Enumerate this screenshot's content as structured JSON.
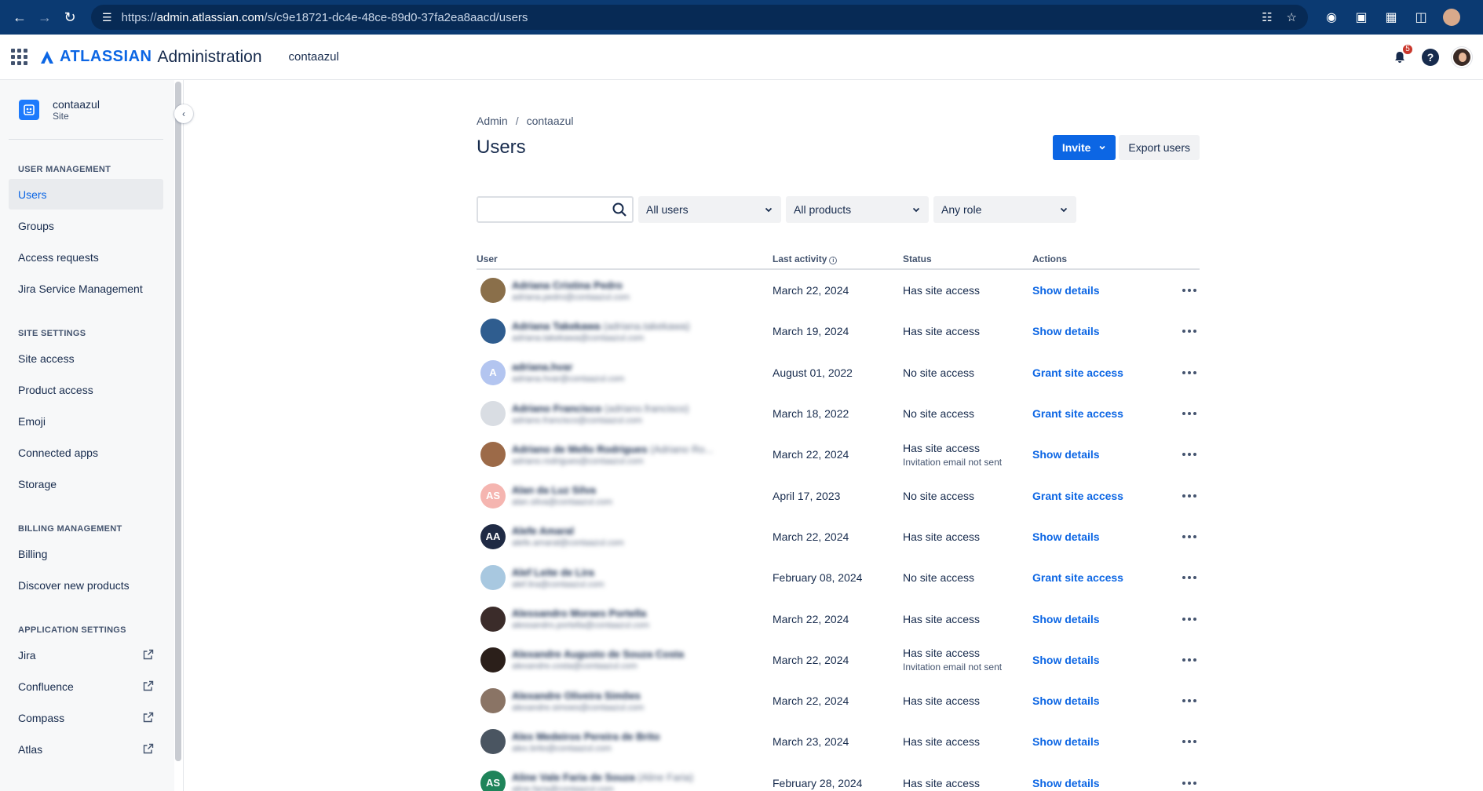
{
  "browser": {
    "url_prefix": "https://",
    "url_domain": "admin.atlassian.com",
    "url_path": "/s/c9e18721-dc4e-48ce-89d0-37fa2ea8aacd/users"
  },
  "header": {
    "brand": "ATLASSIAN",
    "product": "Administration",
    "site": "contaazul",
    "notifications_count": "5",
    "help": "?"
  },
  "sidebar": {
    "site_name": "contaazul",
    "site_type": "Site",
    "sections": [
      {
        "title": "USER MANAGEMENT",
        "items": [
          "Users",
          "Groups",
          "Access requests",
          "Jira Service Management"
        ]
      },
      {
        "title": "SITE SETTINGS",
        "items": [
          "Site access",
          "Product access",
          "Emoji",
          "Connected apps",
          "Storage"
        ]
      },
      {
        "title": "BILLING MANAGEMENT",
        "items": [
          "Billing",
          "Discover new products"
        ]
      },
      {
        "title": "APPLICATION SETTINGS",
        "items": [
          "Jira",
          "Confluence",
          "Compass",
          "Atlas"
        ]
      }
    ]
  },
  "breadcrumb": {
    "root": "Admin",
    "current": "contaazul"
  },
  "page_title": "Users",
  "actions": {
    "invite": "Invite",
    "export": "Export users"
  },
  "filters": {
    "search_placeholder": "",
    "users": "All users",
    "products": "All products",
    "role": "Any role"
  },
  "table": {
    "headers": {
      "user": "User",
      "last_activity": "Last activity",
      "status": "Status",
      "actions": "Actions"
    },
    "rows": [
      {
        "initials": "",
        "avatar_color": "#8a6f4a",
        "name": "Adriana Cristina Pedro",
        "alt": "",
        "email": "adriana.pedro@contaazul.com",
        "activity": "March 22, 2024",
        "status": "Has site access",
        "sub": "",
        "action": "Show details"
      },
      {
        "initials": "",
        "avatar_color": "#2f5d8f",
        "name": "Adriana Takekawa",
        "alt": "(adriana.takekawa)",
        "email": "adriana.takekawa@contaazul.com",
        "activity": "March 19, 2024",
        "status": "Has site access",
        "sub": "",
        "action": "Show details"
      },
      {
        "initials": "A",
        "avatar_color": "#b3c5f0",
        "name": "adriana.hvar",
        "alt": "",
        "email": "adriana.hvar@contaazul.com",
        "activity": "August 01, 2022",
        "status": "No site access",
        "sub": "",
        "action": "Grant site access"
      },
      {
        "initials": "",
        "avatar_color": "#d9dde3",
        "name": "Adriano Francisco",
        "alt": "(adriano.francisco)",
        "email": "adriano.francisco@contaazul.com",
        "activity": "March 18, 2022",
        "status": "No site access",
        "sub": "",
        "action": "Grant site access"
      },
      {
        "initials": "",
        "avatar_color": "#9c6a48",
        "name": "Adriano de Mello Rodrigues",
        "alt": "(Adriano Ro...",
        "email": "adriano.rodrigues@contaazul.com",
        "activity": "March 22, 2024",
        "status": "Has site access",
        "sub": "Invitation email not sent",
        "action": "Show details"
      },
      {
        "initials": "AS",
        "avatar_color": "#f5b5b0",
        "name": "Alan da Luz Silva",
        "alt": "",
        "email": "alan.silva@contaazul.com",
        "activity": "April 17, 2023",
        "status": "No site access",
        "sub": "",
        "action": "Grant site access"
      },
      {
        "initials": "AA",
        "avatar_color": "#1f2a44",
        "name": "Alefe Amaral",
        "alt": "",
        "email": "alefe.amaral@contaazul.com",
        "activity": "March 22, 2024",
        "status": "Has site access",
        "sub": "",
        "action": "Show details"
      },
      {
        "initials": "",
        "avatar_color": "#a8c8e0",
        "name": "Alef Leite de Lira",
        "alt": "",
        "email": "alef.lira@contaazul.com",
        "activity": "February 08, 2024",
        "status": "No site access",
        "sub": "",
        "action": "Grant site access"
      },
      {
        "initials": "",
        "avatar_color": "#3b2c2a",
        "name": "Alessandro Moraes Portella",
        "alt": "",
        "email": "alessandro.portella@contaazul.com",
        "activity": "March 22, 2024",
        "status": "Has site access",
        "sub": "",
        "action": "Show details"
      },
      {
        "initials": "",
        "avatar_color": "#2b1f1a",
        "name": "Alexandre Augusto de Souza Costa",
        "alt": "",
        "email": "alexandre.costa@contaazul.com",
        "activity": "March 22, 2024",
        "status": "Has site access",
        "sub": "Invitation email not sent",
        "action": "Show details"
      },
      {
        "initials": "",
        "avatar_color": "#8a7465",
        "name": "Alexandre Oliveira Simões",
        "alt": "",
        "email": "alexandre.simoes@contaazul.com",
        "activity": "March 22, 2024",
        "status": "Has site access",
        "sub": "",
        "action": "Show details"
      },
      {
        "initials": "",
        "avatar_color": "#4a5561",
        "name": "Alex Medeiros Pereira de Brito",
        "alt": "",
        "email": "alex.brito@contaazul.com",
        "activity": "March 23, 2024",
        "status": "Has site access",
        "sub": "",
        "action": "Show details"
      },
      {
        "initials": "AS",
        "avatar_color": "#1f845a",
        "name": "Aline Vale Faria de Souza",
        "alt": "(Aline Faria)",
        "email": "aline.faria@contaazul.com",
        "activity": "February 28, 2024",
        "status": "Has site access",
        "sub": "",
        "action": "Show details"
      }
    ]
  },
  "icons": {
    "app_switcher": "grid-icon",
    "notifications": "bell-icon",
    "help": "question-icon",
    "search": "search-icon",
    "external": "external-link-icon"
  },
  "colors": {
    "brand": "#0c66e4",
    "browser_bar": "#0b3a72",
    "sidebar_bg": "#f7f8f9"
  }
}
